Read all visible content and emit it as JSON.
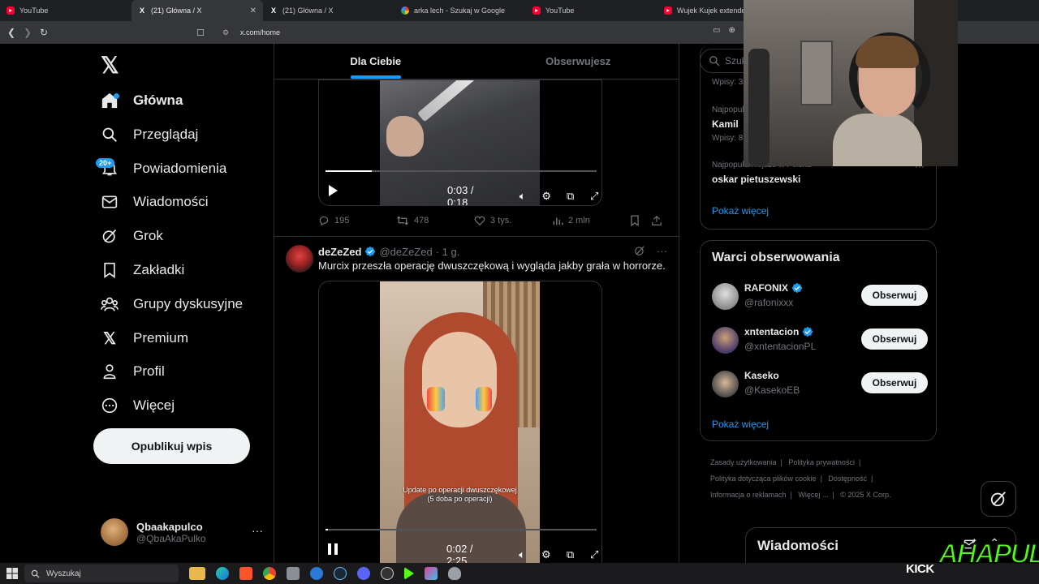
{
  "browser": {
    "tabs": [
      {
        "title": "YouTube",
        "icon": "youtube-icon",
        "active": false
      },
      {
        "title": "(21) Główna / X",
        "icon": "x-icon",
        "active": true
      },
      {
        "title": "(21) Główna / X",
        "icon": "x-icon",
        "active": false
      },
      {
        "title": "arka lech - Szukaj w Google",
        "icon": "google-icon",
        "active": false
      },
      {
        "title": "YouTube",
        "icon": "youtube-icon",
        "active": false
      },
      {
        "title": "Wujek Kujek extended",
        "icon": "youtube-icon",
        "active": false
      }
    ],
    "url": "x.com/home"
  },
  "nav": {
    "logo": "𝕏",
    "items": [
      {
        "label": "Główna",
        "icon": "home-icon",
        "active": true
      },
      {
        "label": "Przeglądaj",
        "icon": "search-icon"
      },
      {
        "label": "Powiadomienia",
        "icon": "bell-icon",
        "badge": "20+"
      },
      {
        "label": "Wiadomości",
        "icon": "envelope-icon"
      },
      {
        "label": "Grok",
        "icon": "grok-icon"
      },
      {
        "label": "Zakładki",
        "icon": "bookmark-icon"
      },
      {
        "label": "Grupy dyskusyjne",
        "icon": "communities-icon"
      },
      {
        "label": "Premium",
        "icon": "x-icon"
      },
      {
        "label": "Profil",
        "icon": "profile-icon"
      },
      {
        "label": "Więcej",
        "icon": "more-circle-icon"
      }
    ],
    "post_button": "Opublikuj wpis",
    "account": {
      "name": "Qbaakapulco",
      "handle": "@QbaAkaPulko",
      "more": "···"
    }
  },
  "feed": {
    "tabs": [
      "Dla Ciebie",
      "Obserwujesz"
    ],
    "video1": {
      "time": "0:03 / 0:18",
      "progress": 0.17
    },
    "post1_actions": {
      "replies": "195",
      "reposts": "478",
      "likes": "3 tys.",
      "views": "2 mln"
    },
    "post2": {
      "name": "deZeZed",
      "handle": "@deZeZed",
      "time": "· 1 g.",
      "text": "Murcix przeszła operację dwuszczękową i wygląda jakby grała w horrorze.",
      "video_caption_line1": "Update po operacji dwuszczękowej",
      "video_caption_line2": "(5 doba po operacji)",
      "video_time": "0:02 / 2:25",
      "progress": 0.01
    }
  },
  "right": {
    "search_placeholder": "Szukaj",
    "trends": [
      {
        "meta": "Wpisy: 3",
        "name": ""
      },
      {
        "meta": "Najpopularniejsze",
        "name": "Kamil",
        "meta2": "Wpisy: 8"
      },
      {
        "meta": "Najpopularniejsze w Polska",
        "name": "oskar pietuszewski"
      }
    ],
    "show_more": "Pokaż więcej",
    "who_to_follow": {
      "title": "Warci obserwowania",
      "people": [
        {
          "name": "RAFONIX",
          "handle": "@rafonixxx",
          "verified": true
        },
        {
          "name": "xntentacion",
          "handle": "@xntentacionPL",
          "verified": true
        },
        {
          "name": "Kaseko",
          "handle": "@KasekoEB",
          "verified": false
        }
      ],
      "follow_label": "Obserwuj",
      "show_more": "Pokaż więcej"
    },
    "footer": {
      "links": [
        "Zasady użytkowania",
        "Polityka prywatności",
        "Polityka dotycząca plików cookie",
        "Dostępność",
        "Informacja o reklamach",
        "Więcej ..."
      ],
      "copyright": "© 2025 X Corp."
    },
    "messages_drawer": "Wiadomości"
  },
  "taskbar": {
    "search_placeholder": "Wyszukaj"
  },
  "overlay": {
    "kick": "KICK",
    "brand": "AHAPULCO"
  }
}
